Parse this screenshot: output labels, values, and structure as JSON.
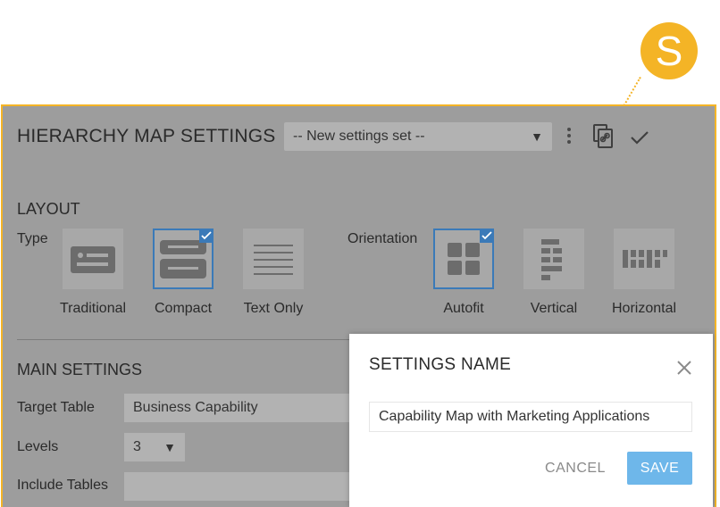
{
  "callout": {
    "letter": "S",
    "color": "#f4b426"
  },
  "header": {
    "title": "HIERARCHY MAP SETTINGS",
    "settings_set": "-- New settings set --",
    "icons": [
      "more-vertical-icon",
      "copy-link-icon",
      "check-icon"
    ]
  },
  "layout": {
    "section_title": "LAYOUT",
    "type_label": "Type",
    "orientation_label": "Orientation",
    "types": [
      {
        "label": "Traditional",
        "selected": false
      },
      {
        "label": "Compact",
        "selected": true
      },
      {
        "label": "Text Only",
        "selected": false
      }
    ],
    "orientations": [
      {
        "label": "Autofit",
        "selected": true
      },
      {
        "label": "Vertical",
        "selected": false
      },
      {
        "label": "Horizontal",
        "selected": false
      }
    ]
  },
  "main_settings": {
    "section_title": "MAIN SETTINGS",
    "target_table_label": "Target Table",
    "target_table_value": "Business Capability",
    "levels_label": "Levels",
    "levels_value": "3",
    "include_tables_label": "Include Tables",
    "include_tables_value": ""
  },
  "dialog": {
    "title": "SETTINGS NAME",
    "name_value": "Capability Map with Marketing Applications",
    "cancel_label": "CANCEL",
    "save_label": "SAVE"
  },
  "colors": {
    "accent": "#f4b426",
    "selection": "#3b7ab8",
    "save_button": "#6eb7ea",
    "overlay": "#9d9d9d"
  }
}
